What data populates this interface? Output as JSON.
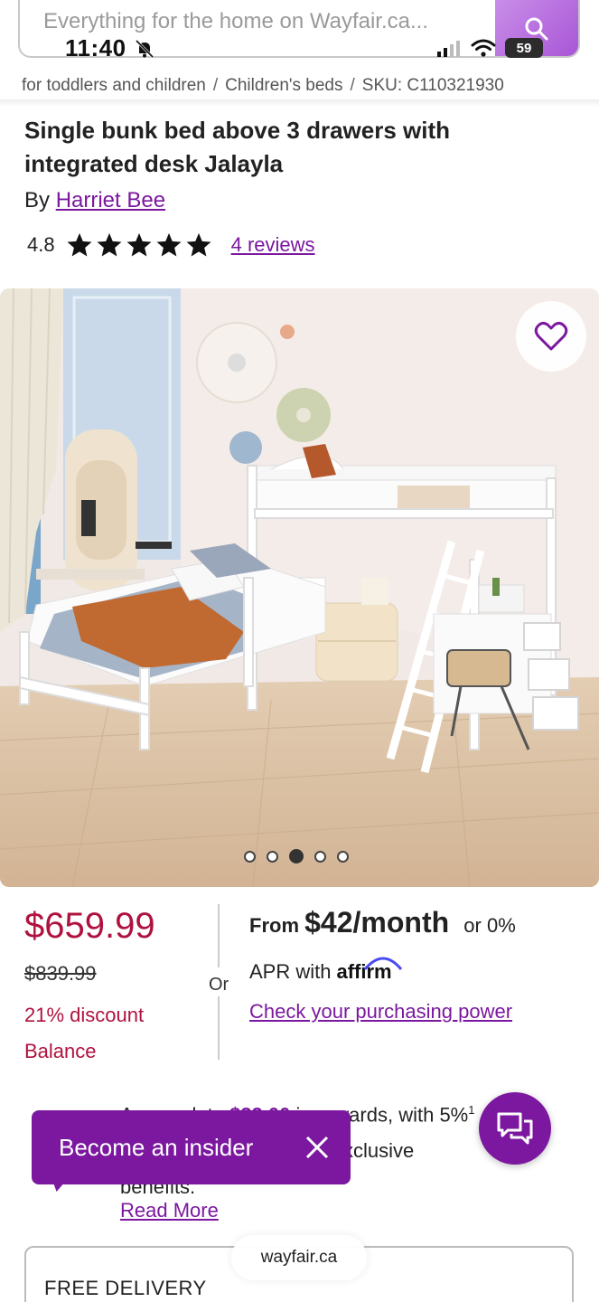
{
  "search": {
    "placeholder": "Everything for the home on Wayfair.ca..."
  },
  "status_bar": {
    "time": "11:40",
    "battery": "59"
  },
  "breadcrumb": {
    "items": [
      "for toddlers and children",
      "Children's beds",
      "SKU: C110321930"
    ],
    "separator": "/"
  },
  "product": {
    "title": "Single bunk bed above 3 drawers with integrated desk Jalayla",
    "by_prefix": "By",
    "brand": "Harriet Bee",
    "rating": "4.8",
    "stars": 5,
    "reviews_label": "4 reviews"
  },
  "gallery": {
    "total_images": 5,
    "active_index": 2
  },
  "pricing": {
    "price": "$659.99",
    "original_price": "$839.99",
    "discount": "21% discount",
    "balance": "Balance",
    "or_label": "Or"
  },
  "financing": {
    "from_label": "From",
    "monthly_amount": "$42/month",
    "apr_suffix": "or 0%",
    "apr_line": "APR with",
    "provider": "affirm",
    "link": "Check your purchasing power"
  },
  "rewards": {
    "prefix": "Accumulate",
    "amount": "$33.00",
    "suffix": "in rewards, with 5%",
    "line2": "and get access to other exclusive",
    "line3": "benefits.",
    "superscript": "1",
    "read_more": "Read More"
  },
  "insider_toast": {
    "label": "Become an insider"
  },
  "delivery": {
    "label": "FREE DELIVERY"
  },
  "browser": {
    "url": "wayfair.ca"
  },
  "colors": {
    "accent": "#7b189f",
    "price": "#b0123f",
    "search_button": "#b36ddb"
  }
}
